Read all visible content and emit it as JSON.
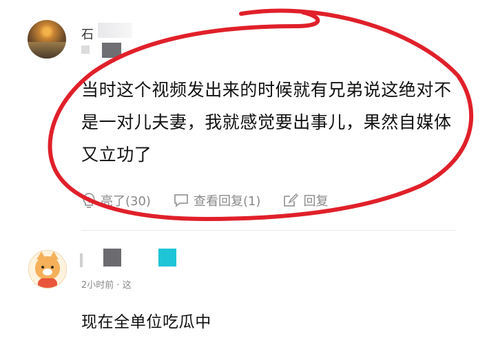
{
  "comments": [
    {
      "name": "石",
      "text": "当时这个视频发出来的时候就有兄弟说这绝对不是一对儿夫妻，我就感觉要出事儿，果然自媒体又立功了",
      "actions": {
        "like": "亮了(30)",
        "view_replies": "查看回复(1)",
        "reply": "回复"
      }
    },
    {
      "name": "",
      "time": "2小时前 · 这",
      "text": "现在全单位吃瓜中"
    }
  ],
  "colors": {
    "annotation_red": "#e0202a",
    "censor_gray": "#6b6b70",
    "censor_cyan": "#1ec5d6"
  }
}
